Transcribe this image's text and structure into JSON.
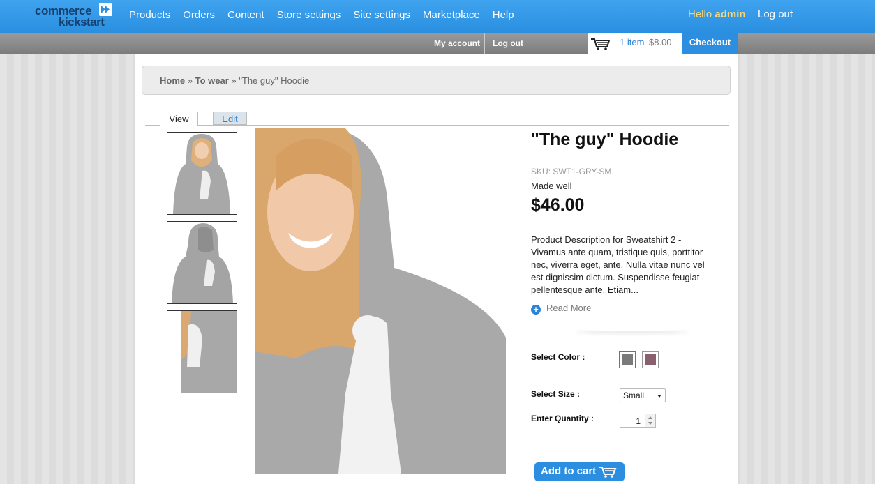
{
  "admin_bar": {
    "logo_line1": "commerce",
    "logo_line2": "kickstart",
    "menu": [
      "Products",
      "Orders",
      "Content",
      "Store settings",
      "Site settings",
      "Marketplace",
      "Help"
    ],
    "hello": "Hello",
    "username": "admin",
    "logout": "Log out"
  },
  "user_bar": {
    "my_account": "My account",
    "logout": "Log out",
    "cart_items": "1 item",
    "cart_total": "$8.00",
    "checkout": "Checkout"
  },
  "breadcrumb": {
    "home": "Home",
    "sep": "»",
    "category": "To wear",
    "current": "\"The guy\" Hoodie"
  },
  "tabs": {
    "view": "View",
    "edit": "Edit"
  },
  "product": {
    "title": "\"The guy\" Hoodie",
    "sku": "SKU: SWT1-GRY-SM",
    "tagline": "Made well",
    "price": "$46.00",
    "description": "Product Description for Sweatshirt 2 - Vivamus ante quam, tristique quis, porttitor nec, viverra eget, ante. Nulla vitae nunc vel est dignissim dictum. Suspendisse feugiat pellentesque ante. Etiam...",
    "read_more": "Read More",
    "color_label": "Select Color :",
    "colors": [
      "#7a7a7a",
      "#8a5f6e"
    ],
    "size_label": "Select Size :",
    "size_value": "Small",
    "qty_label": "Enter Quantity :",
    "qty_value": "1",
    "add_to_cart": "Add to cart"
  },
  "colors": {
    "accent": "#2b8ee0",
    "admin_bar": "#3fa3ef",
    "hello": "#f6d97a"
  }
}
